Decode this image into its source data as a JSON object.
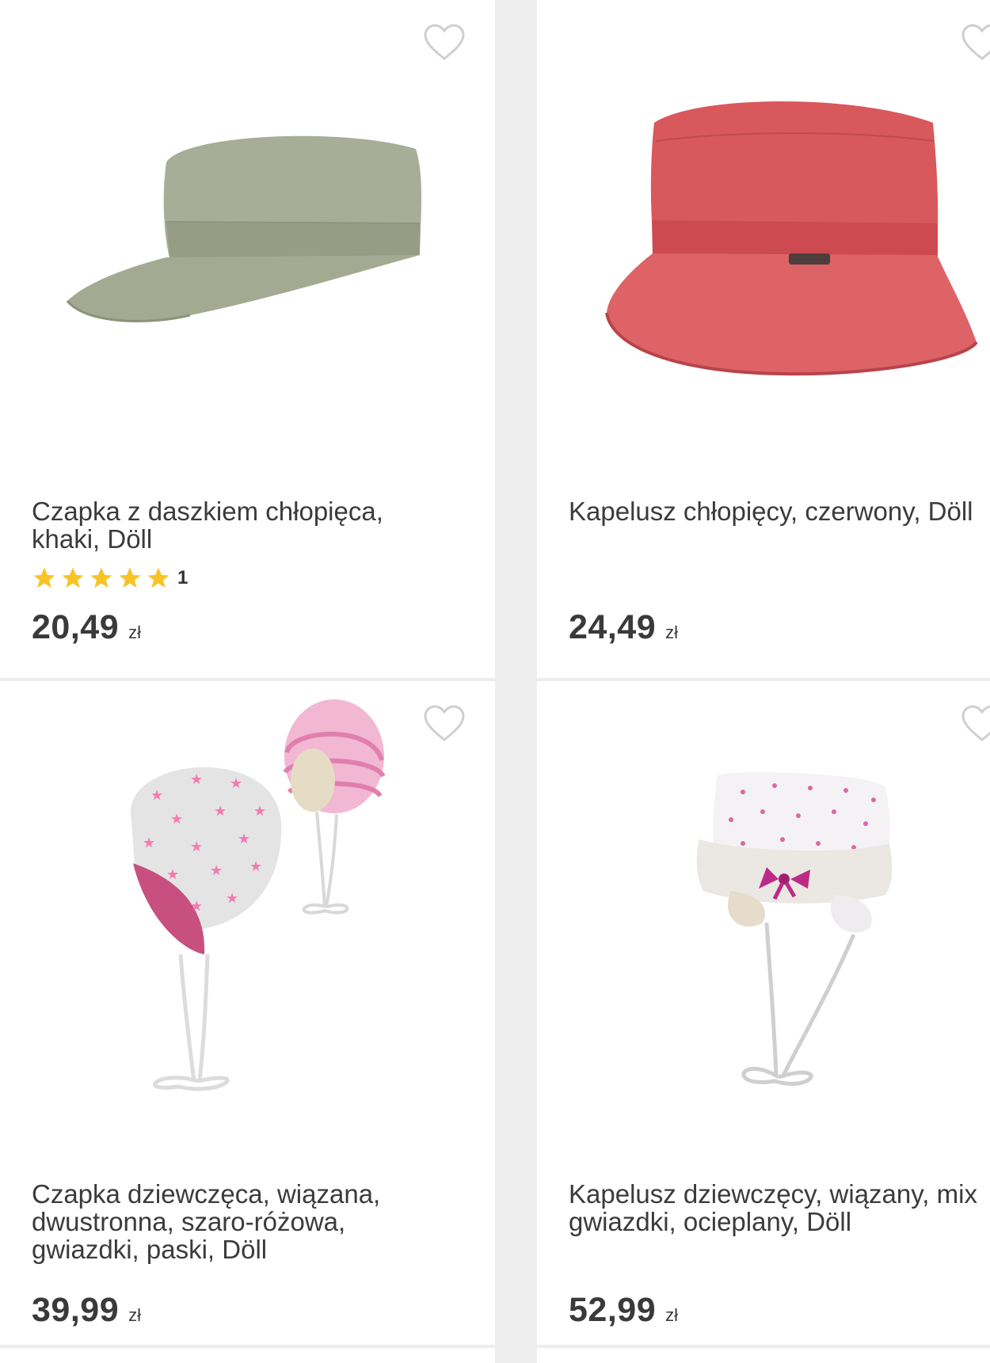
{
  "products": [
    {
      "title": "Czapka z daszkiem chłopięca,\nkhaki, Döll",
      "rating_count": "1",
      "rating_stars": 5,
      "price": "20,49",
      "currency": "zł",
      "image_icon": "khaki-cap-image"
    },
    {
      "title": "Kapelusz chłopięcy, czerwony, Döll",
      "price": "24,49",
      "currency": "zł",
      "image_icon": "red-bucket-hat-image"
    },
    {
      "title": "Czapka dziewczęca, wiązana,\ndwustronna, szaro-różowa,\ngwiazdki, paski, Döll",
      "price": "39,99",
      "currency": "zł",
      "image_icon": "pink-star-baby-hats-image"
    },
    {
      "title": "Kapelusz dziewczęcy, wiązany, mix\ngwiazdki, ocieplany, Döll",
      "price": "52,99",
      "currency": "zł",
      "image_icon": "white-winter-hat-image"
    }
  ],
  "icons": {
    "favorite": "heart-outline-icon",
    "rating": "star-icon"
  },
  "colors": {
    "star": "#f7c325",
    "text": "#3b3b3b",
    "background": "#eeeeee"
  }
}
